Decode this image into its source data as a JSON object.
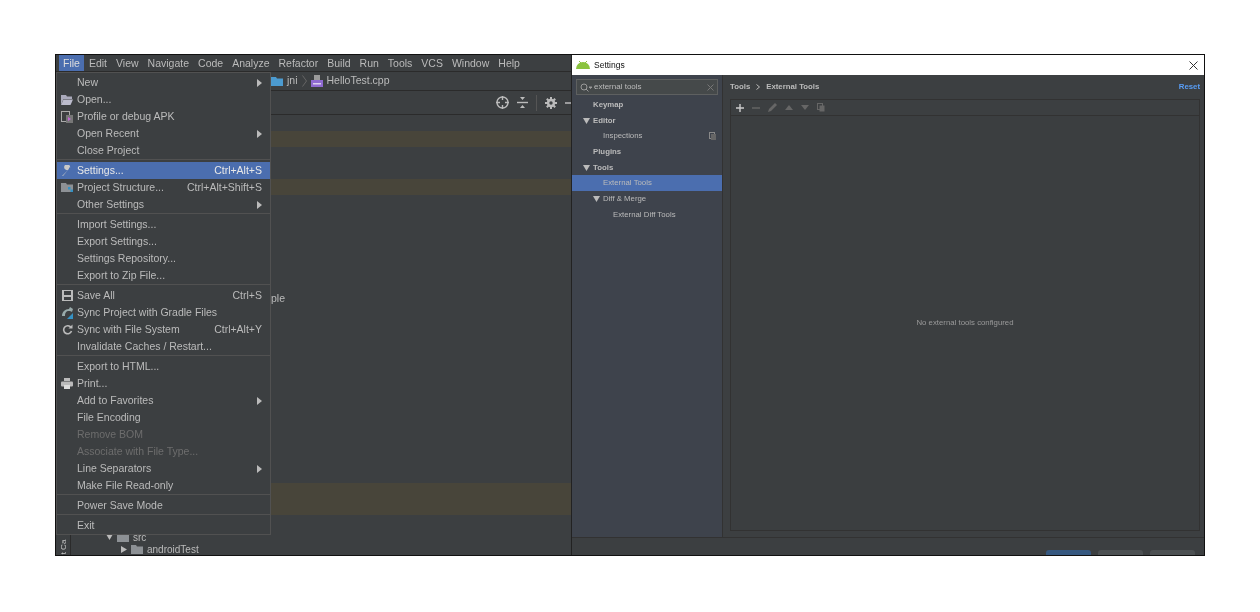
{
  "ide": {
    "menubar": [
      {
        "label": "File",
        "selected": true
      },
      {
        "label": "Edit",
        "selected": false
      },
      {
        "label": "View",
        "selected": false
      },
      {
        "label": "Navigate",
        "selected": false
      },
      {
        "label": "Code",
        "selected": false
      },
      {
        "label": "Analyze",
        "selected": false
      },
      {
        "label": "Refactor",
        "selected": false
      },
      {
        "label": "Build",
        "selected": false
      },
      {
        "label": "Run",
        "selected": false
      },
      {
        "label": "Tools",
        "selected": false
      },
      {
        "label": "VCS",
        "selected": false
      },
      {
        "label": "Window",
        "selected": false
      },
      {
        "label": "Help",
        "selected": false
      }
    ],
    "breadcrumb": [
      {
        "label": "jni",
        "kind": "folder"
      },
      {
        "label": "HelloTest.cpp",
        "kind": "cpp"
      }
    ],
    "side_tab": "t Ca",
    "partial_text": "ple",
    "project_tree": [
      {
        "label": "src",
        "expanded": true,
        "children": [
          {
            "label": "androidTest",
            "expanded": false
          }
        ]
      }
    ]
  },
  "file_menu": [
    {
      "kind": "item",
      "label": "New",
      "submenu": true,
      "disabled": false,
      "selected": false
    },
    {
      "kind": "item",
      "label": "Open...",
      "submenu": false,
      "disabled": false,
      "selected": false
    },
    {
      "kind": "item",
      "label": "Profile or debug APK",
      "submenu": false,
      "disabled": false,
      "selected": false
    },
    {
      "kind": "item",
      "label": "Open Recent",
      "submenu": true,
      "disabled": false,
      "selected": false
    },
    {
      "kind": "item",
      "label": "Close Project",
      "submenu": false,
      "disabled": false,
      "selected": false
    },
    {
      "kind": "separator"
    },
    {
      "kind": "item",
      "label": "Settings...",
      "shortcut": "Ctrl+Alt+S",
      "submenu": false,
      "disabled": false,
      "selected": true
    },
    {
      "kind": "item",
      "label": "Project Structure...",
      "shortcut": "Ctrl+Alt+Shift+S",
      "submenu": false,
      "disabled": false,
      "selected": false
    },
    {
      "kind": "item",
      "label": "Other Settings",
      "submenu": true,
      "disabled": false,
      "selected": false
    },
    {
      "kind": "separator"
    },
    {
      "kind": "item",
      "label": "Import Settings...",
      "submenu": false,
      "disabled": false,
      "selected": false
    },
    {
      "kind": "item",
      "label": "Export Settings...",
      "submenu": false,
      "disabled": false,
      "selected": false
    },
    {
      "kind": "item",
      "label": "Settings Repository...",
      "submenu": false,
      "disabled": false,
      "selected": false
    },
    {
      "kind": "item",
      "label": "Export to Zip File...",
      "submenu": false,
      "disabled": false,
      "selected": false
    },
    {
      "kind": "separator"
    },
    {
      "kind": "item",
      "label": "Save All",
      "shortcut": "Ctrl+S",
      "submenu": false,
      "disabled": false,
      "selected": false
    },
    {
      "kind": "item",
      "label": "Sync Project with Gradle Files",
      "submenu": false,
      "disabled": false,
      "selected": false
    },
    {
      "kind": "item",
      "label": "Sync with File System",
      "shortcut": "Ctrl+Alt+Y",
      "submenu": false,
      "disabled": false,
      "selected": false
    },
    {
      "kind": "item",
      "label": "Invalidate Caches / Restart...",
      "submenu": false,
      "disabled": false,
      "selected": false
    },
    {
      "kind": "separator"
    },
    {
      "kind": "item",
      "label": "Export to HTML...",
      "submenu": false,
      "disabled": false,
      "selected": false
    },
    {
      "kind": "item",
      "label": "Print...",
      "submenu": false,
      "disabled": false,
      "selected": false
    },
    {
      "kind": "item",
      "label": "Add to Favorites",
      "submenu": true,
      "disabled": false,
      "selected": false
    },
    {
      "kind": "item",
      "label": "File Encoding",
      "submenu": false,
      "disabled": false,
      "selected": false
    },
    {
      "kind": "item",
      "label": "Remove BOM",
      "submenu": false,
      "disabled": true,
      "selected": false
    },
    {
      "kind": "item",
      "label": "Associate with File Type...",
      "submenu": false,
      "disabled": true,
      "selected": false
    },
    {
      "kind": "item",
      "label": "Line Separators",
      "submenu": true,
      "disabled": false,
      "selected": false
    },
    {
      "kind": "item",
      "label": "Make File Read-only",
      "submenu": false,
      "disabled": false,
      "selected": false
    },
    {
      "kind": "separator"
    },
    {
      "kind": "item",
      "label": "Power Save Mode",
      "submenu": false,
      "disabled": false,
      "selected": false
    },
    {
      "kind": "separator"
    },
    {
      "kind": "item",
      "label": "Exit",
      "submenu": false,
      "disabled": false,
      "selected": false
    }
  ],
  "settings": {
    "title": "Settings",
    "search": {
      "value": "external tools"
    },
    "tree": [
      {
        "label": "Keymap",
        "selected": false
      },
      {
        "label": "Editor",
        "selected": false,
        "expanded": true,
        "children": [
          {
            "label": "Inspections",
            "selected": false,
            "marked": true
          }
        ]
      },
      {
        "label": "Plugins",
        "selected": false
      },
      {
        "label": "Tools",
        "selected": false,
        "expanded": true,
        "children": [
          {
            "label": "External Tools",
            "selected": true
          },
          {
            "label": "Diff & Merge",
            "selected": false,
            "expanded": true,
            "children": [
              {
                "label": "External Diff Tools",
                "selected": false
              }
            ]
          }
        ]
      }
    ],
    "breadcrumb": [
      "Tools",
      "External Tools"
    ],
    "reset": "Reset",
    "empty_message": "No external tools configured",
    "buttons": [
      {
        "primary": true
      },
      {
        "primary": false
      },
      {
        "primary": false
      }
    ]
  }
}
